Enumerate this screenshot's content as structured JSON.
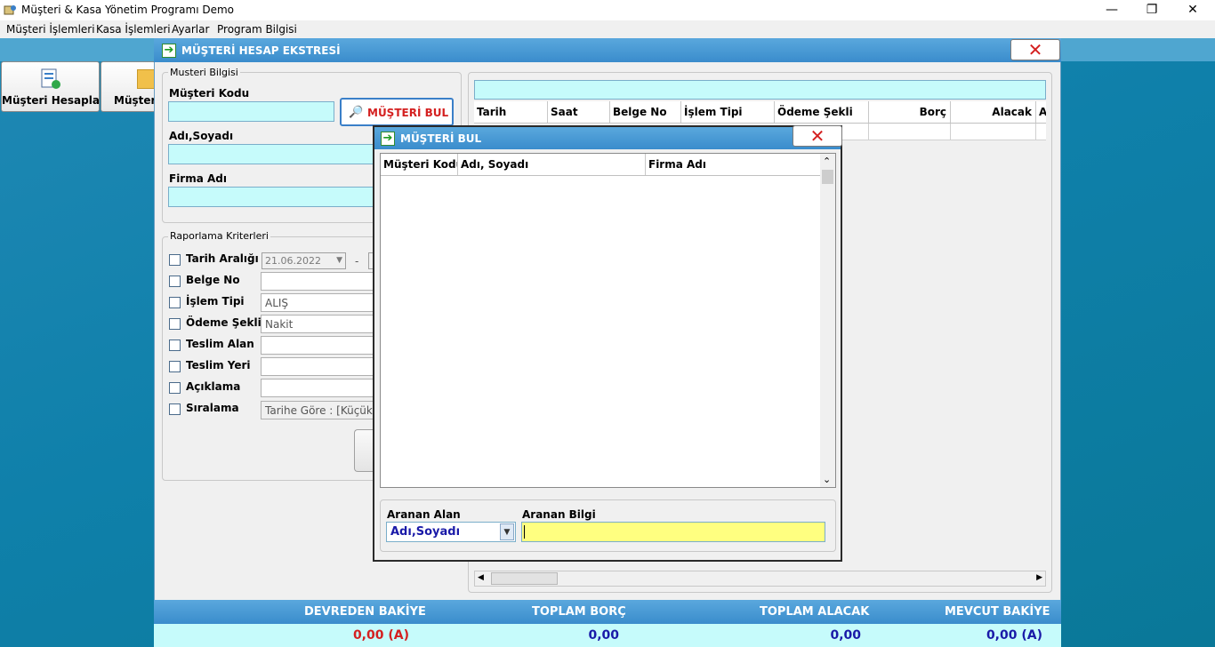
{
  "window": {
    "title": "Müşteri & Kasa Yönetim Programı Demo",
    "minimize": "—",
    "restore": "❐",
    "close": "✕"
  },
  "menu": [
    "Müşteri İşlemleri",
    "Kasa İşlemleri",
    "Ayarlar",
    "Program Bilgisi"
  ],
  "toolbar": {
    "btn1_label": "Müşteri Hesapları",
    "btn2_label": "Müşteri"
  },
  "statement_window": {
    "title": "MÜŞTERİ HESAP EKSTRESİ",
    "close_icon": "close-icon",
    "customer_group": {
      "legend": "Musteri Bilgisi",
      "code_label": "Müşteri Kodu",
      "find_button": "MÜŞTERİ BUL",
      "name_label": "Adı,Soyadı",
      "company_label": "Firma Adı"
    },
    "criteria_group": {
      "legend": "Raporlama Kriterleri",
      "items": [
        {
          "label": "Tarih Aralığı",
          "value": "21.06.2022"
        },
        {
          "label": "Belge No",
          "value": ""
        },
        {
          "label": "İşlem Tipi",
          "value": "ALIŞ"
        },
        {
          "label": "Ödeme Şekli",
          "value": "Nakit"
        },
        {
          "label": "Teslim Alan",
          "value": ""
        },
        {
          "label": "Teslim Yeri",
          "value": ""
        },
        {
          "label": "Açıklama",
          "value": ""
        },
        {
          "label": "Sıralama",
          "value": "Tarihe Göre : [Küçük"
        }
      ],
      "date_separator": "-"
    },
    "grid": {
      "columns": [
        "Tarih",
        "Saat",
        "Belge No",
        "İşlem Tipi",
        "Ödeme Şekli",
        "Borç",
        "Alacak",
        "A"
      ]
    },
    "footer": {
      "devreden_label": "DEVREDEN BAKİYE",
      "devreden_value": "0,00",
      "devreden_suffix": "(A)",
      "borc_label": "TOPLAM BORÇ",
      "borc_value": "0,00",
      "alacak_label": "TOPLAM ALACAK",
      "alacak_value": "0,00",
      "mevcut_label": "MEVCUT BAKİYE",
      "mevcut_value": "0,00",
      "mevcut_suffix": "(A)"
    }
  },
  "find_dialog": {
    "title": "MÜŞTERİ BUL",
    "columns": [
      "Müşteri Kodu",
      "Adı, Soyadı",
      "Firma Adı"
    ],
    "search_field_label": "Aranan Alan",
    "search_field_value": "Adı,Soyadı",
    "search_text_label": "Aranan Bilgi",
    "search_text_value": ""
  },
  "colors": {
    "accent": "#3a8ccc",
    "cyan_field": "#c6fbfb",
    "search_yellow": "#ffff80",
    "alert_red": "#d42020",
    "value_blue": "#1a1aa8"
  }
}
